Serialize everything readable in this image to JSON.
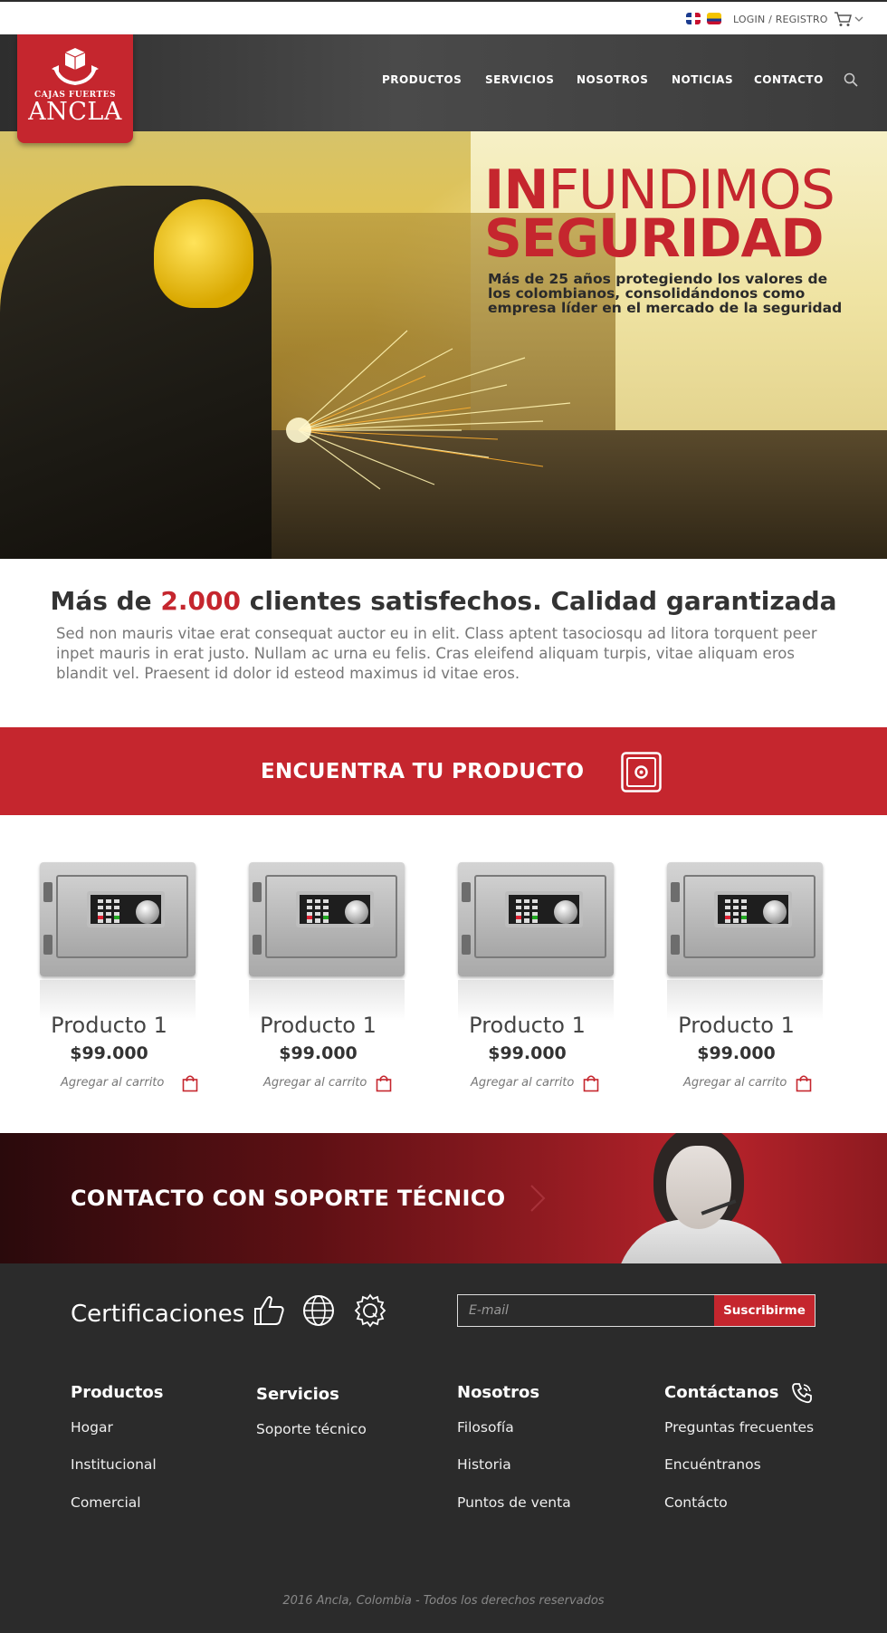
{
  "topbar": {
    "flags": [
      "dominican-republic-flag",
      "colombia-flag"
    ],
    "login_label": "LOGIN / REGISTRO",
    "cart_icon": "cart-icon"
  },
  "brand": {
    "small": "CAJAS FUERTES",
    "name": "ANCLA",
    "color": "#c5262e"
  },
  "nav": {
    "items": [
      "PRODUCTOS",
      "SERVICIOS",
      "NOSOTROS",
      "NOTICIAS",
      "CONTACTO"
    ],
    "search_icon": "search-icon"
  },
  "hero": {
    "title_bold": "IN",
    "title_rest": "FUNDIMOS",
    "title_line2": "SEGURIDAD",
    "subtitle": "Más de  25 años protegiendo los valores de los colombianos, consolidándonos como empresa líder en el mercado de la seguridad"
  },
  "intro": {
    "title_prefix": "Más de ",
    "title_accent": "2.000",
    "title_suffix": " clientes satisfechos. Calidad garantizada",
    "text": "Sed non mauris vitae erat consequat auctor eu in elit. Class aptent tasociosqu ad litora torquent peer inpet mauris in erat justo. Nullam ac urna eu felis. Cras eleifend aliquam turpis, vitae aliquam eros blandit vel. Praesent id dolor id esteod maximus id vitae eros."
  },
  "find": {
    "title": "ENCUENTRA TU PRODUCTO"
  },
  "products": [
    {
      "name": "Producto 1",
      "price": "$99.000",
      "add_label": "Agregar al carrito"
    },
    {
      "name": "Producto 1",
      "price": "$99.000",
      "add_label": "Agregar al carrito"
    },
    {
      "name": "Producto 1",
      "price": "$99.000",
      "add_label": "Agregar al carrito"
    },
    {
      "name": "Producto 1",
      "price": "$99.000",
      "add_label": "Agregar al carrito"
    }
  ],
  "support": {
    "title": "CONTACTO CON SOPORTE TÉCNICO"
  },
  "footer": {
    "cert_title": "Certificaciones",
    "cert_icons": [
      "thumbs-up-icon",
      "globe-icon",
      "quality-gear-icon"
    ],
    "email_placeholder": "E-mail",
    "subscribe_label": "Suscribirme",
    "columns": [
      {
        "title": "Productos",
        "links": [
          "Hogar",
          "Institucional",
          "Comercial"
        ]
      },
      {
        "title": "Servicios",
        "links": [
          "Soporte técnico"
        ]
      },
      {
        "title": "Nosotros",
        "links": [
          "Filosofía",
          "Historia",
          "Puntos de venta"
        ]
      },
      {
        "title": "Contáctanos",
        "links": [
          "Preguntas frecuentes",
          "Encuéntranos",
          "Contácto"
        ]
      }
    ],
    "copyright": "2016 Ancla, Colombia - Todos los derechos reservados"
  }
}
